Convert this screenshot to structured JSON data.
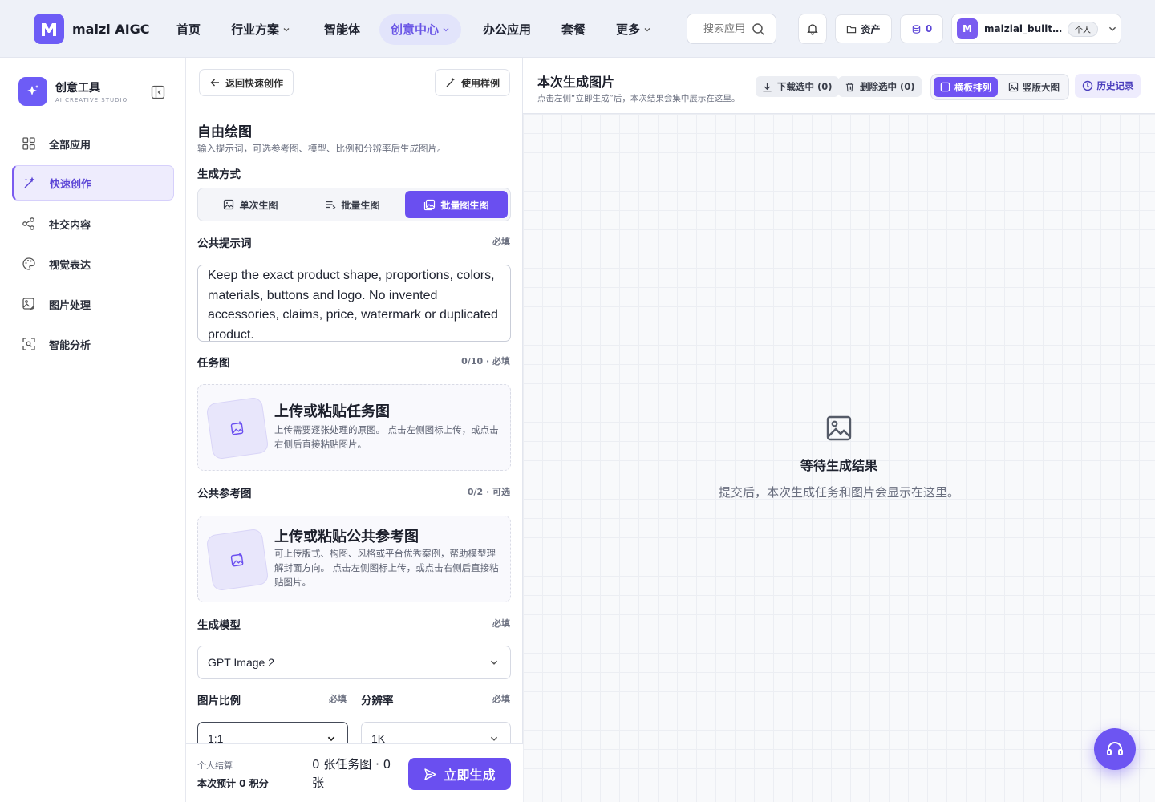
{
  "brand": {
    "name": "maizi AIGC"
  },
  "nav": {
    "items": [
      {
        "label": "首页"
      },
      {
        "label": "行业方案"
      },
      {
        "label": "智能体"
      },
      {
        "label": "创意中心"
      },
      {
        "label": "办公应用"
      },
      {
        "label": "套餐"
      },
      {
        "label": "更多"
      }
    ],
    "search_placeholder": "搜索应用",
    "assets_label": "资产",
    "credits": "0",
    "user_initial": "M",
    "username": "maiziai_builtin_user",
    "user_badge": "个人"
  },
  "sidebar": {
    "title": "创意工具",
    "subtitle": "AI CREATIVE STUDIO",
    "items": [
      {
        "label": "全部应用",
        "icon": "grid-icon"
      },
      {
        "label": "快速创作",
        "icon": "magic-wand-icon"
      },
      {
        "label": "社交内容",
        "icon": "share-icon"
      },
      {
        "label": "视觉表达",
        "icon": "palette-icon"
      },
      {
        "label": "图片处理",
        "icon": "image-edit-icon"
      },
      {
        "label": "智能分析",
        "icon": "scan-icon"
      }
    ]
  },
  "form": {
    "back_label": "返回快速创作",
    "sample_label": "使用样例",
    "title": "自由绘图",
    "description": "输入提示词，可选参考图、模型、比例和分辨率后生成图片。",
    "mode_label": "生成方式",
    "modes": [
      "单次生图",
      "批量生图",
      "批量图生图"
    ],
    "prompt_label": "公共提示词",
    "prompt_required": "必填",
    "prompt_value": "Keep the exact product shape, proportions, colors, materials, buttons and logo. No invented accessories, claims, price, watermark or duplicated product.",
    "task_label": "任务图",
    "task_count": "0/10 · 必填",
    "task_upload_title": "上传或粘贴任务图",
    "task_upload_desc": "上传需要逐张处理的原图。 点击左侧图标上传，或点击右侧后直接粘贴图片。",
    "ref_label": "公共参考图",
    "ref_count": "0/2 · 可选",
    "ref_upload_title": "上传或粘贴公共参考图",
    "ref_upload_desc": "可上传版式、构图、风格或平台优秀案例，帮助模型理解封面方向。 点击左侧图标上传，或点击右侧后直接粘贴图片。",
    "model_label": "生成模型",
    "model_required": "必填",
    "model_value": "GPT Image 2",
    "ratio_label": "图片比例",
    "ratio_required": "必填",
    "ratio_value": "1:1",
    "resolution_label": "分辨率",
    "resolution_required": "必填",
    "resolution_value": "1K"
  },
  "footer": {
    "settle_label": "个人结算",
    "estimate": "本次预计 0 积分",
    "summary": "0 张任务图 · 0 张",
    "generate_label": "立即生成"
  },
  "results": {
    "title": "本次生成图片",
    "subtitle": "点击左侧“立即生成”后，本次结果会集中展示在这里。",
    "download_label": "下载选中 (0)",
    "delete_label": "删除选中 (0)",
    "view_grid_label": "横板排列",
    "view_large_label": "竖版大图",
    "history_label": "历史记录",
    "empty_title": "等待生成结果",
    "empty_desc": "提交后，本次生成任务和图片会显示在这里。"
  },
  "colors": {
    "accent": "#6a4ff0",
    "accent_light": "#eeecfd"
  }
}
